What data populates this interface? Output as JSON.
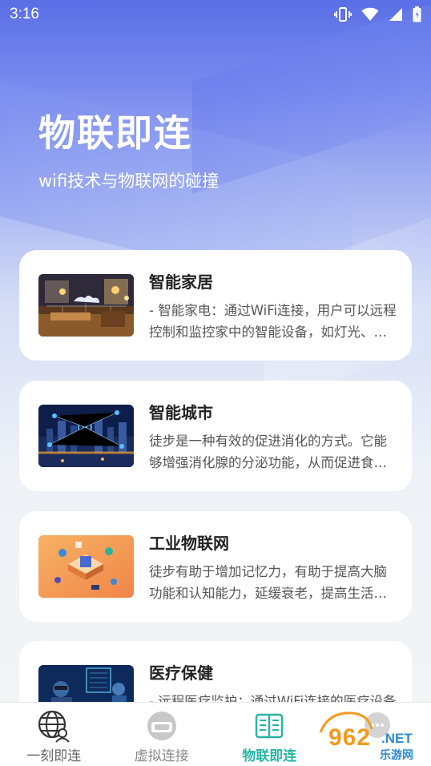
{
  "status_bar": {
    "time": "3:16",
    "icons": [
      "vibrate-icon",
      "wifi-icon",
      "signal-icon",
      "battery-icon"
    ]
  },
  "hero": {
    "title": "物联即连",
    "subtitle": "wifi技术与物联网的碰撞"
  },
  "cards": [
    {
      "title": "智能家居",
      "desc": "- 智能家电：通过WiFi连接，用户可以远程控制和监控家中的智能设备，如灯光、空调等。",
      "thumb": "smart-home-image"
    },
    {
      "title": "智能城市",
      "desc": "徒步是一种有效的促进消化的方式。它能够增强消化腺的分泌功能，从而促进食物的消化和吸收。",
      "thumb": "smart-city-image"
    },
    {
      "title": "工业物联网",
      "desc": "徒步有助于增加记忆力，有助于提高大脑功能和认知能力，延缓衰老，提高生活质量。",
      "thumb": "industrial-iot-image"
    },
    {
      "title": "医疗保健",
      "desc": "- 远程医疗监护：通过WiFi连接的医疗设备实现远程监护。",
      "thumb": "healthcare-image"
    }
  ],
  "bottom_nav": {
    "items": [
      {
        "label": "一刻即连",
        "icon": "globe-user-icon",
        "active": false
      },
      {
        "label": "虚拟连接",
        "icon": "vr-headset-icon",
        "active": false
      },
      {
        "label": "物联即连",
        "icon": "book-icon",
        "active": true
      },
      {
        "label": "",
        "icon": "chat-icon",
        "active": false
      }
    ]
  },
  "watermark": {
    "brand": "962",
    "domain": ".NET",
    "name": "乐游网"
  },
  "colors": {
    "accent": "#24b6a3",
    "hero_gradient_top": "#5a6fe6",
    "card_bg": "#ffffff",
    "watermark_orange": "#f39a1e",
    "watermark_blue": "#2c8ad9"
  }
}
